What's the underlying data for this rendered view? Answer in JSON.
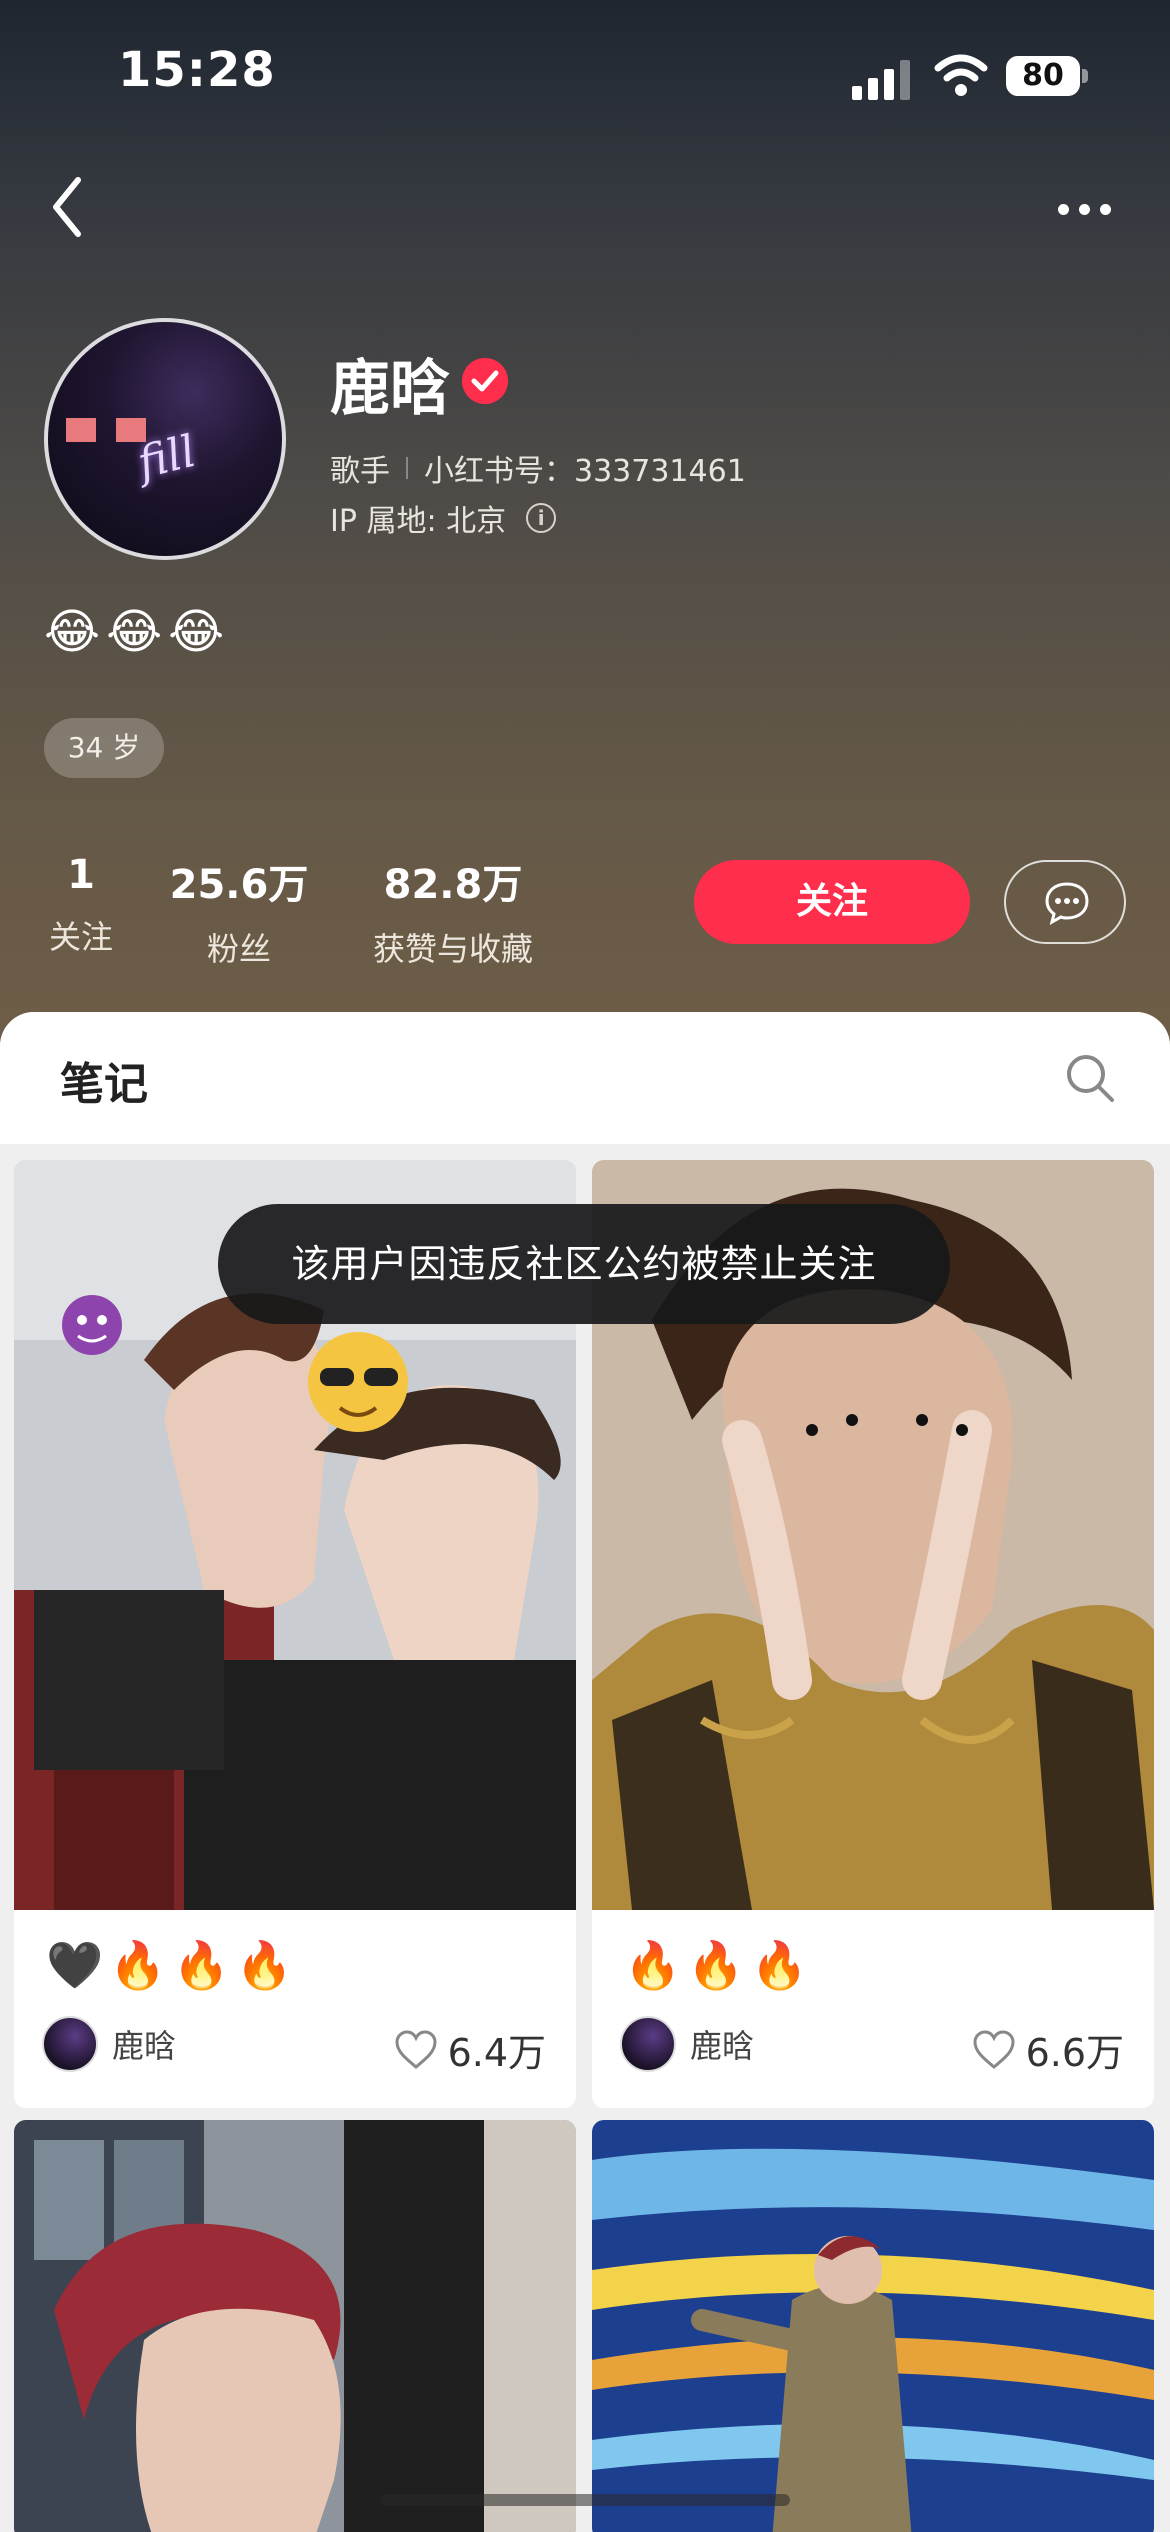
{
  "status_bar": {
    "time": "15:28",
    "battery": "80"
  },
  "profile": {
    "name": "鹿晗",
    "role": "歌手",
    "red_id": "小红书号：333731461",
    "ip_location": "IP 属地: 北京",
    "bio": "😂😂😂",
    "age_tag": "34 岁"
  },
  "stats": [
    {
      "value": "1",
      "label": "关注"
    },
    {
      "value": "25.6万",
      "label": "粉丝"
    },
    {
      "value": "82.8万",
      "label": "获赞与收藏"
    }
  ],
  "actions": {
    "follow_label": "关注"
  },
  "tabs": {
    "notes": "笔记"
  },
  "cards": [
    {
      "title": "🖤🔥🔥🔥",
      "author": "鹿晗",
      "likes": "6.4万"
    },
    {
      "title": "🔥🔥🔥",
      "author": "鹿晗",
      "likes": "6.6万"
    }
  ],
  "toast": "该用户因违反社区公约被禁止关注",
  "colors": {
    "accent": "#ff2e4d",
    "header_top": "#1f2630",
    "header_bottom": "#6f5e47"
  }
}
